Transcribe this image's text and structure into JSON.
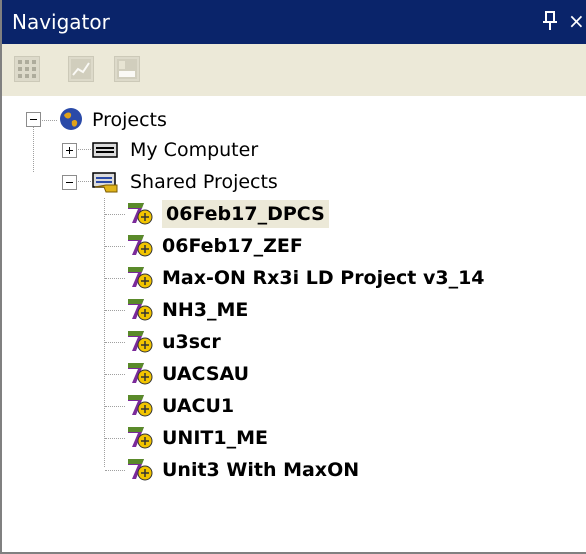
{
  "window": {
    "title": "Navigator",
    "pin_glyph": "฿",
    "close_glyph": "×"
  },
  "toolbar": {
    "buttons": [
      "grid-view-icon",
      "chart-icon",
      "layout-icon"
    ]
  },
  "tree": {
    "root": {
      "label": "Projects",
      "icon": "globe-icon",
      "expanded": true
    },
    "my_computer": {
      "label": "My Computer",
      "icon": "computer-icon",
      "expanded": false
    },
    "shared_projects": {
      "label": "Shared Projects",
      "icon": "shared-folder-icon",
      "expanded": true
    },
    "projects": [
      "06Feb17_DPCS",
      "06Feb17_ZEF",
      "Max-ON Rx3i LD Project v3_14",
      "NH3_ME",
      "u3scr",
      "UACSAU",
      "UACU1",
      "UNIT1_ME",
      "Unit3 With MaxON"
    ],
    "selected_project": "06Feb17_DPCS"
  },
  "colors": {
    "titlebar": "#0a246a",
    "toolbar": "#ece9d8",
    "selection": "#ece9d8",
    "tree_line": "#a0a0a0",
    "project_icon_purple": "#7a2a9a",
    "project_icon_yellow": "#f2c400"
  }
}
